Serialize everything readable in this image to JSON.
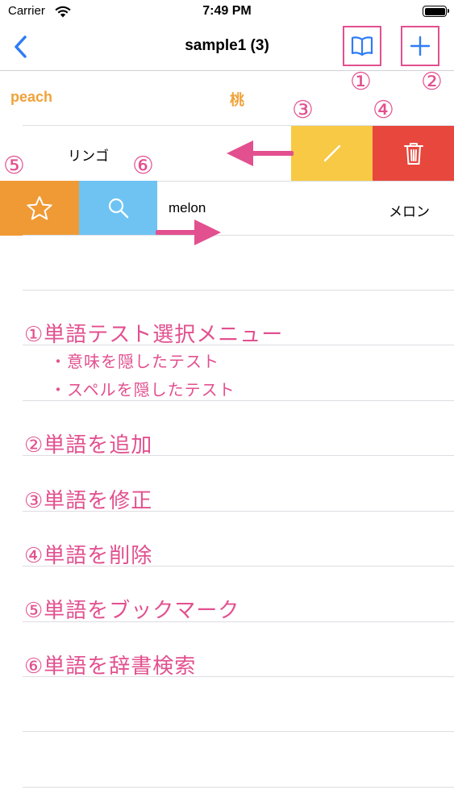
{
  "status_bar": {
    "carrier": "Carrier",
    "time": "7:49 PM"
  },
  "nav": {
    "title": "sample1 (3)",
    "back_icon": "chevron-left-icon",
    "test_icon": "book-icon",
    "add_icon": "plus-icon"
  },
  "rows": [
    {
      "word": "peach",
      "meaning": "桃",
      "color": "#f0a23a"
    },
    {
      "meaning": "リンゴ",
      "actions": {
        "edit_icon": "pencil-icon",
        "delete_icon": "trash-icon",
        "edit_color": "#f7c945",
        "delete_color": "#e8473e"
      }
    },
    {
      "word": "melon",
      "meaning": "メロン",
      "actions": {
        "bookmark_icon": "star-icon",
        "search_icon": "search-icon",
        "bookmark_color": "#f09a35",
        "search_color": "#6ec3f3"
      }
    }
  ],
  "annotations": {
    "markers": [
      "①",
      "②",
      "③",
      "④",
      "⑤",
      "⑥"
    ],
    "color": "#e2508f",
    "legend": [
      {
        "text": "①単語テスト選択メニュー",
        "subs": [
          "・意味を隠したテスト",
          "・スペルを隠したテスト"
        ]
      },
      {
        "text": "②単語を追加"
      },
      {
        "text": "③単語を修正"
      },
      {
        "text": "④単語を削除"
      },
      {
        "text": "⑤単語をブックマーク"
      },
      {
        "text": "⑥単語を辞書検索"
      }
    ]
  }
}
